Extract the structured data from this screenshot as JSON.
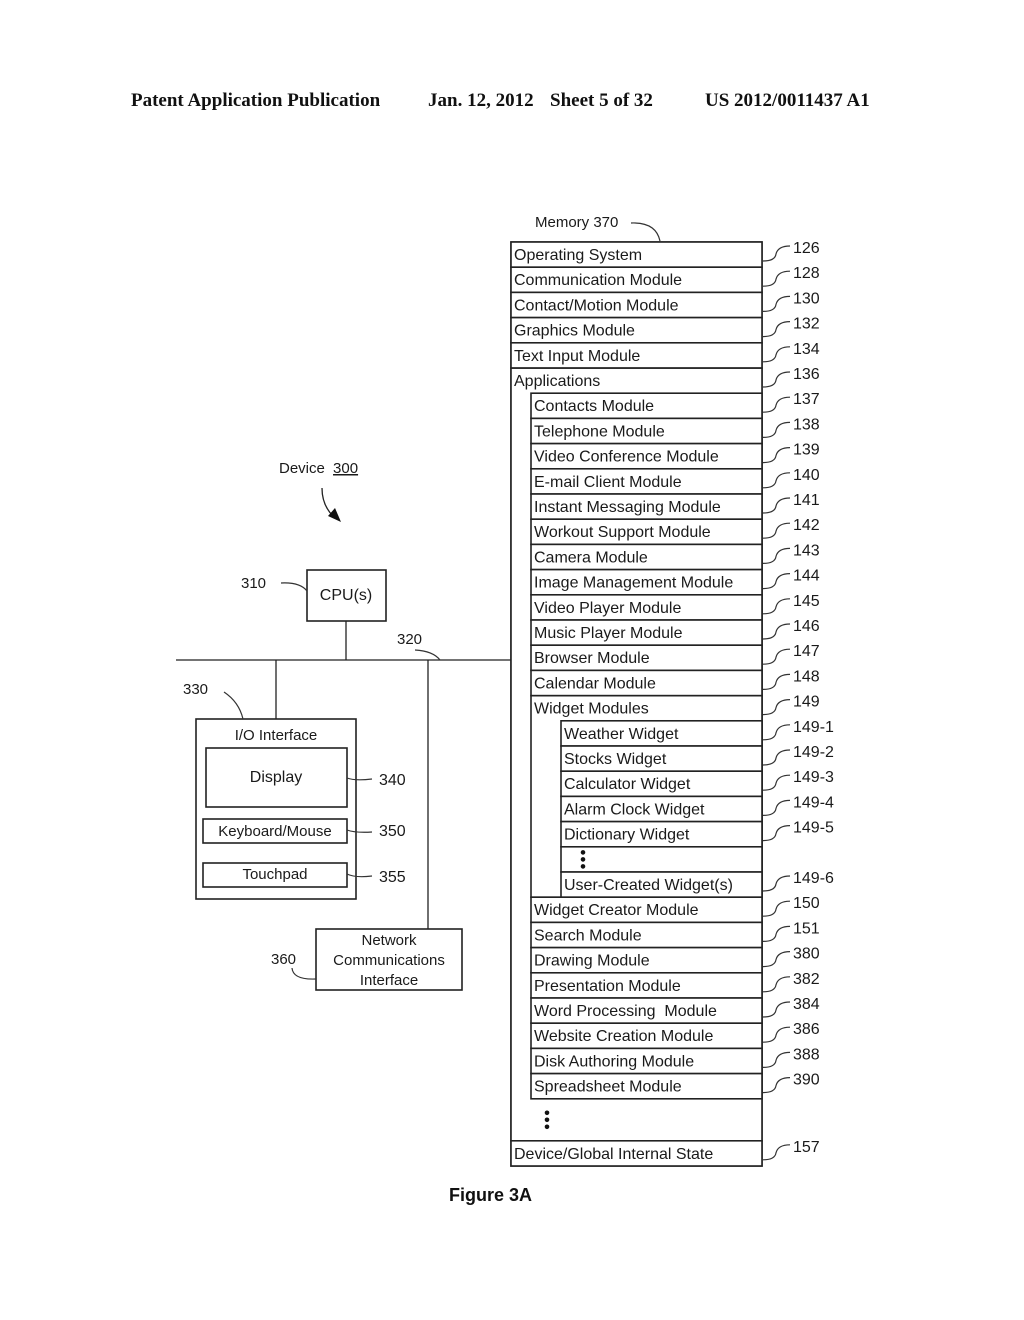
{
  "header": {
    "publication": "Patent Application Publication",
    "date": "Jan. 12, 2012",
    "sheet": "Sheet 5 of 32",
    "number": "US 2012/0011437 A1"
  },
  "figure": {
    "caption": "Figure 3A",
    "device": {
      "label": "Device",
      "ref": "300"
    },
    "cpu": {
      "label": "CPU(s)",
      "ref": "310"
    },
    "bus": {
      "ref": "320"
    },
    "io": {
      "label": "I/O Interface",
      "ref": "330",
      "children": [
        {
          "label": "Display",
          "ref": "340"
        },
        {
          "label": "Keyboard/Mouse",
          "ref": "350"
        },
        {
          "label": "Touchpad",
          "ref": "355"
        }
      ]
    },
    "network": {
      "lines": [
        "Network",
        "Communications",
        "Interface"
      ],
      "ref": "360"
    },
    "memory": {
      "label": "Memory 370",
      "rows": [
        {
          "label": "Operating System",
          "ref": "126",
          "level": 0
        },
        {
          "label": "Communication Module",
          "ref": "128",
          "level": 0
        },
        {
          "label": "Contact/Motion Module",
          "ref": "130",
          "level": 0
        },
        {
          "label": "Graphics Module",
          "ref": "132",
          "level": 0
        },
        {
          "label": "Text Input Module",
          "ref": "134",
          "level": 0
        },
        {
          "label": "Applications",
          "ref": "136",
          "level": 0,
          "group": true
        },
        {
          "label": "Contacts Module",
          "ref": "137",
          "level": 1
        },
        {
          "label": "Telephone Module",
          "ref": "138",
          "level": 1
        },
        {
          "label": "Video Conference Module",
          "ref": "139",
          "level": 1
        },
        {
          "label": "E-mail Client Module",
          "ref": "140",
          "level": 1
        },
        {
          "label": "Instant Messaging Module",
          "ref": "141",
          "level": 1
        },
        {
          "label": "Workout Support Module",
          "ref": "142",
          "level": 1
        },
        {
          "label": "Camera Module",
          "ref": "143",
          "level": 1
        },
        {
          "label": "Image Management Module",
          "ref": "144",
          "level": 1
        },
        {
          "label": "Video Player Module",
          "ref": "145",
          "level": 1
        },
        {
          "label": "Music Player Module",
          "ref": "146",
          "level": 1
        },
        {
          "label": "Browser Module",
          "ref": "147",
          "level": 1
        },
        {
          "label": "Calendar Module",
          "ref": "148",
          "level": 1
        },
        {
          "label": "Widget Modules",
          "ref": "149",
          "level": 1,
          "group": true
        },
        {
          "label": "Weather Widget",
          "ref": "149-1",
          "level": 2
        },
        {
          "label": "Stocks Widget",
          "ref": "149-2",
          "level": 2
        },
        {
          "label": "Calculator Widget",
          "ref": "149-3",
          "level": 2
        },
        {
          "label": "Alarm Clock Widget",
          "ref": "149-4",
          "level": 2
        },
        {
          "label": "Dictionary Widget",
          "ref": "149-5",
          "level": 2
        },
        {
          "label": "",
          "ref": "",
          "level": 2,
          "ellipsis": true
        },
        {
          "label": "User-Created Widget(s)",
          "ref": "149-6",
          "level": 2
        },
        {
          "label": "Widget Creator Module",
          "ref": "150",
          "level": 1
        },
        {
          "label": "Search Module",
          "ref": "151",
          "level": 1
        },
        {
          "label": "Drawing Module",
          "ref": "380",
          "level": 1
        },
        {
          "label": "Presentation Module",
          "ref": "382",
          "level": 1
        },
        {
          "label": "Word Processing  Module",
          "ref": "384",
          "level": 1
        },
        {
          "label": "Website Creation Module",
          "ref": "386",
          "level": 1
        },
        {
          "label": "Disk Authoring Module",
          "ref": "388",
          "level": 1
        },
        {
          "label": "Spreadsheet Module",
          "ref": "390",
          "level": 1
        },
        {
          "label": "",
          "ref": "",
          "level": 0,
          "ellipsis": true,
          "gap": true
        },
        {
          "label": "Device/Global Internal State",
          "ref": "157",
          "level": 0
        }
      ]
    }
  }
}
